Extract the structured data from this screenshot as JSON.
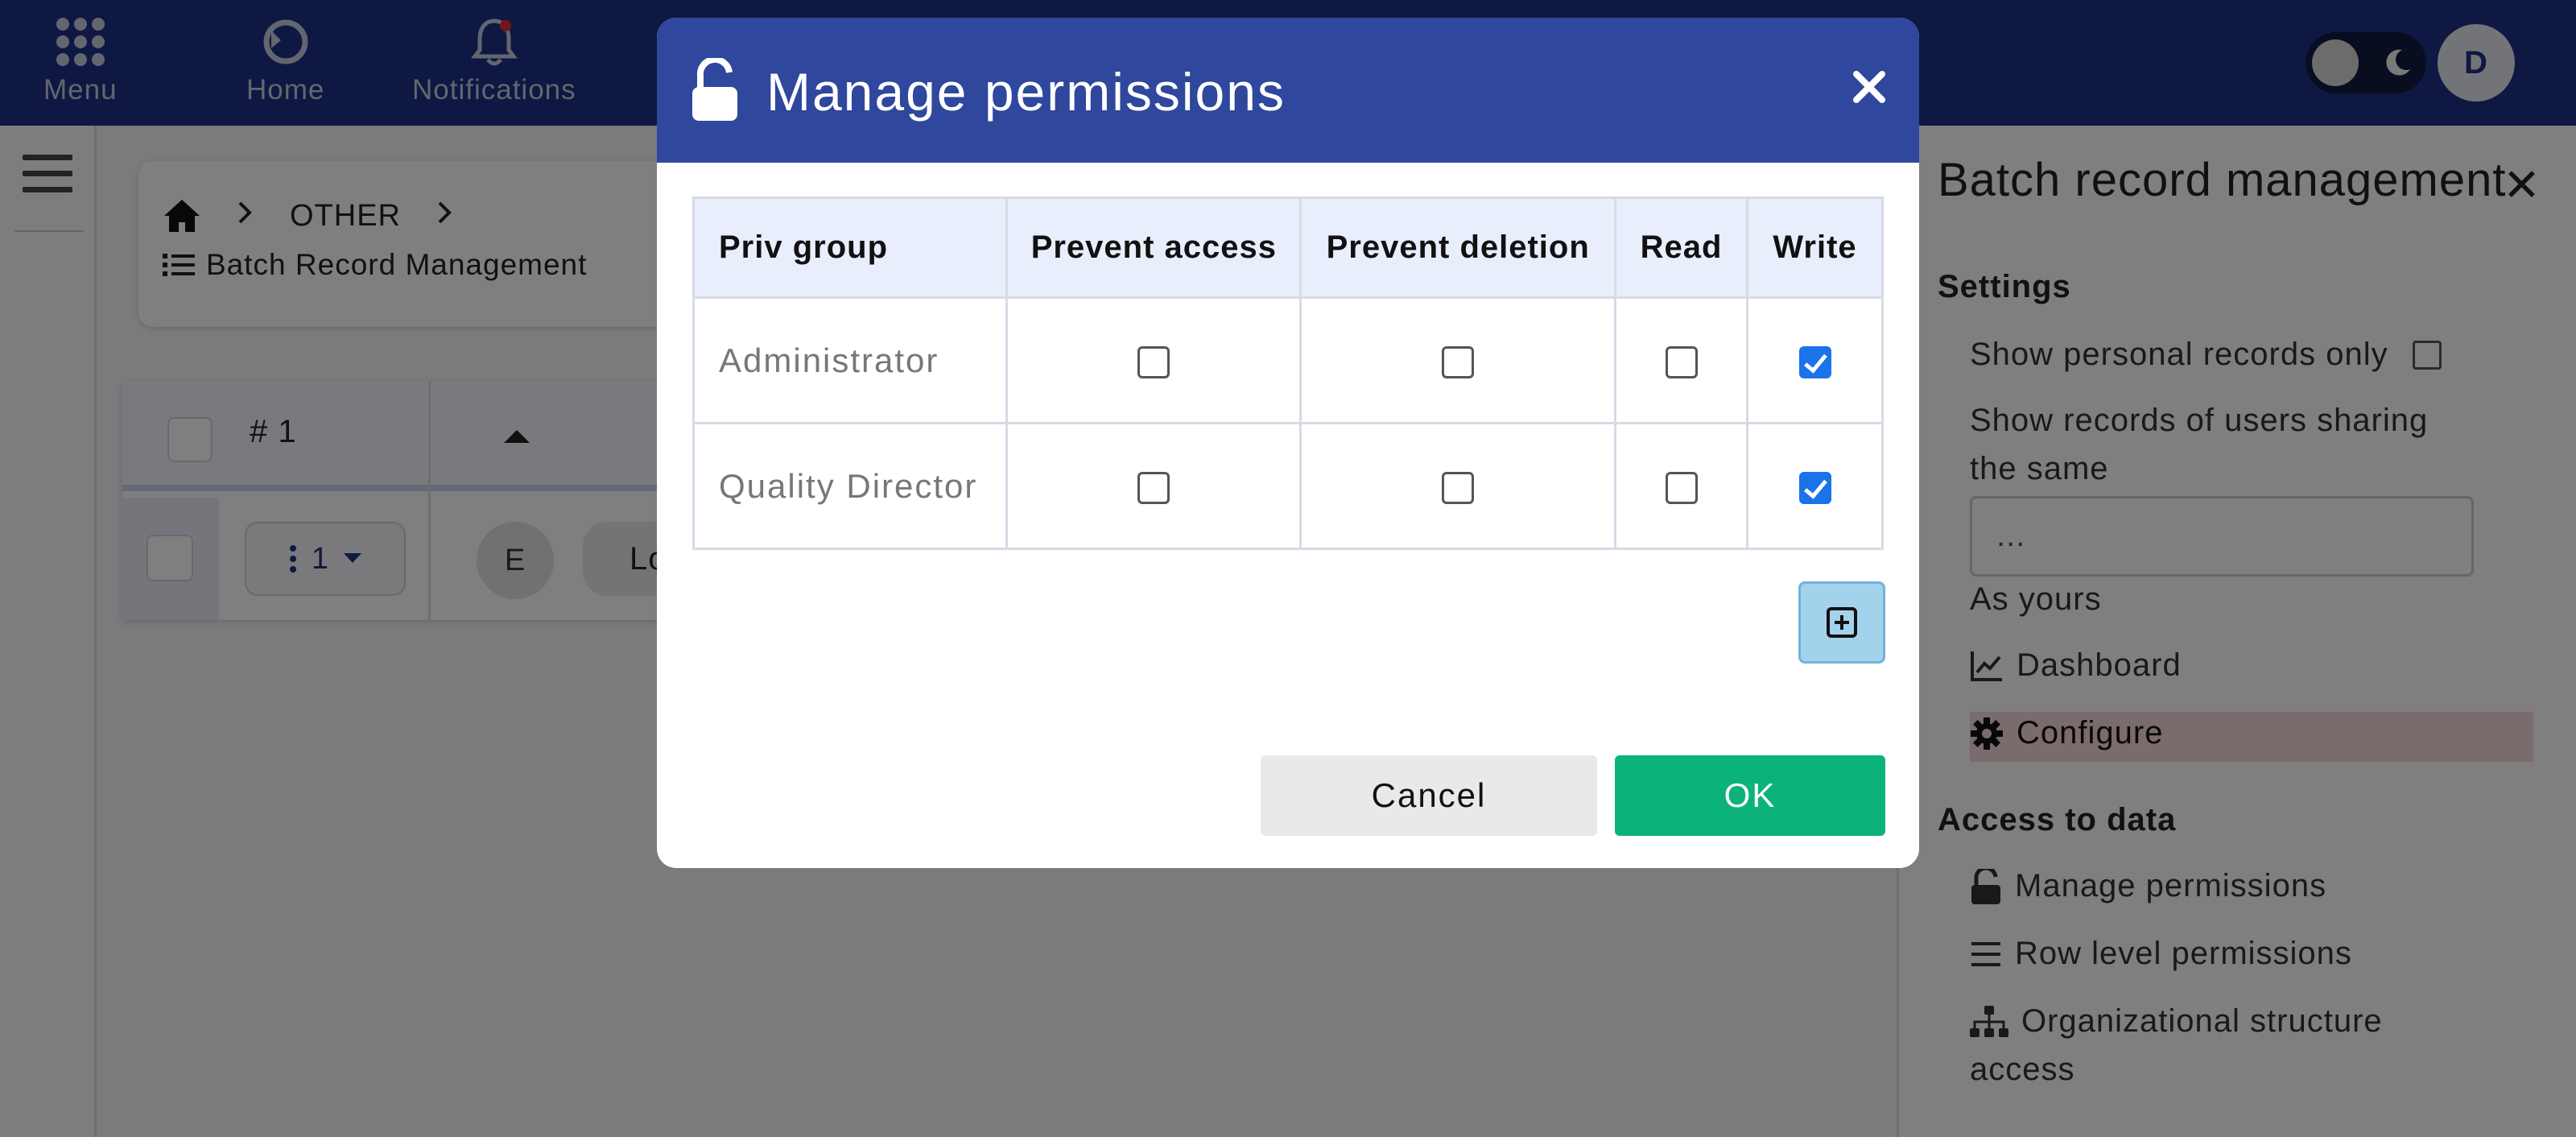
{
  "topbar": {
    "menu_label": "Menu",
    "home_label": "Home",
    "notifications_label": "Notifications",
    "avatar_initial": "D"
  },
  "breadcrumb": {
    "section": "OTHER",
    "page": "Batch Record Management"
  },
  "grid": {
    "column_label": "# 1",
    "row_number": "1",
    "row_circle": "E",
    "row_pill": "Lo"
  },
  "right_panel": {
    "title": "Batch record management",
    "settings_heading": "Settings",
    "show_personal": "Show personal records only",
    "show_sharing_line1": "Show records of users sharing",
    "show_sharing_line2": "the same",
    "sharing_value": "...",
    "as_yours": "As yours",
    "dashboard": "Dashboard",
    "configure": "Configure",
    "access_heading": "Access to data",
    "manage_permissions": "Manage permissions",
    "row_level": "Row level permissions",
    "org_line1": "Organizational structure",
    "org_line2": "access"
  },
  "modal": {
    "title": "Manage permissions",
    "columns": [
      "Priv group",
      "Prevent access",
      "Prevent deletion",
      "Read",
      "Write"
    ],
    "rows": [
      {
        "group": "Administrator",
        "prevent_access": false,
        "prevent_deletion": false,
        "read": false,
        "write": true
      },
      {
        "group": "Quality Director",
        "prevent_access": false,
        "prevent_deletion": false,
        "read": false,
        "write": true
      }
    ],
    "cancel_label": "Cancel",
    "ok_label": "OK"
  },
  "colors": {
    "topbar": "#1f3185",
    "modal_header": "#2f479c",
    "ok_button": "#0bb37a",
    "checkbox_checked": "#1a73e8"
  }
}
